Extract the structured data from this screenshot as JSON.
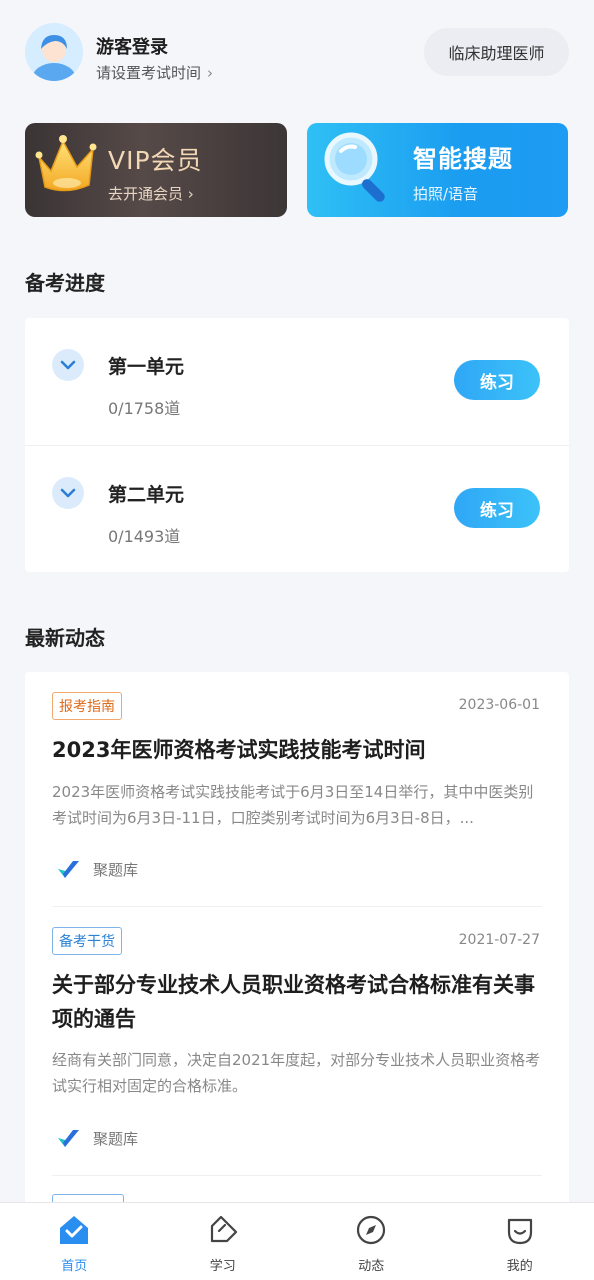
{
  "header": {
    "login_title": "游客登录",
    "login_sub": "请设置考试时间",
    "exam_button": "临床助理医师"
  },
  "promos": {
    "vip_title": "VIP会员",
    "vip_sub": "去开通会员 ›",
    "search_title": "智能搜题",
    "search_sub": "拍照/语音"
  },
  "progress": {
    "section_title": "备考进度",
    "units": [
      {
        "name": "第一单元",
        "count": "0/1758道",
        "button": "练习"
      },
      {
        "name": "第二单元",
        "count": "0/1493道",
        "button": "练习"
      }
    ]
  },
  "news": {
    "section_title": "最新动态",
    "items": [
      {
        "tag": "报考指南",
        "date": "2023-06-01",
        "title": "2023年医师资格考试实践技能考试时间",
        "body": "2023年医师资格考试实践技能考试于6月3日至14日举行，其中中医类别考试时间为6月3日-11日，口腔类别考试时间为6月3日-8日，...",
        "source": "聚题库"
      },
      {
        "tag": "备考干货",
        "date": "2021-07-27",
        "title": "关于部分专业技术人员职业资格考试合格标准有关事项的通告",
        "body": "经商有关部门同意，决定自2021年度起，对部分专业技术人员职业资格考试实行相对固定的合格标准。",
        "source": "聚题库"
      }
    ]
  },
  "nav": {
    "home": "首页",
    "study": "学习",
    "feed": "动态",
    "mine": "我的"
  },
  "colors": {
    "accent": "#2a8ef0",
    "vip_gold": "#f4d8b6",
    "tag_orange": "#e06a1a",
    "tag_blue": "#2a82d8"
  }
}
